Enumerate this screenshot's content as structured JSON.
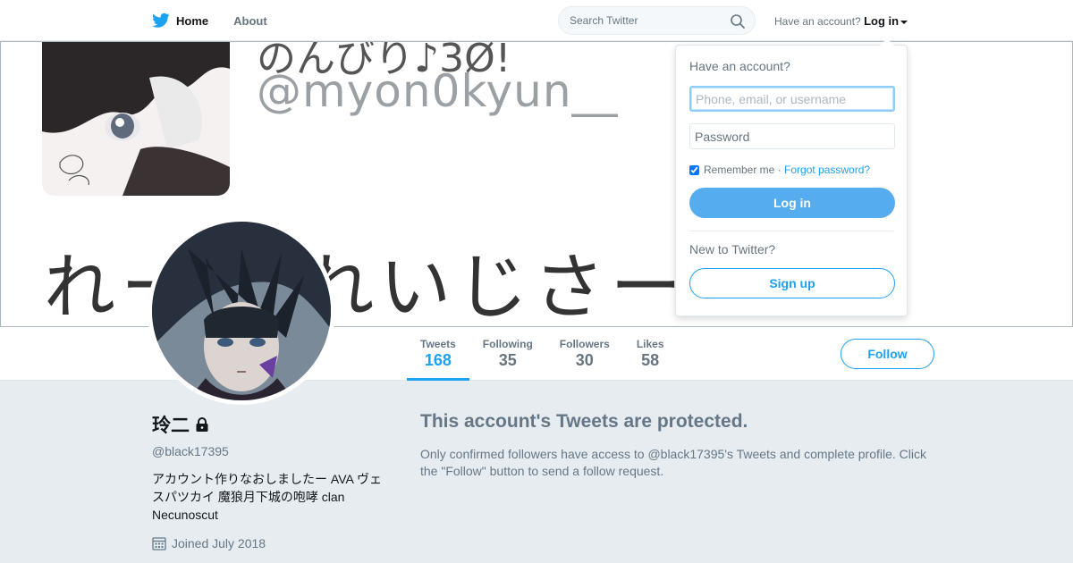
{
  "nav": {
    "home_label": "Home",
    "about_label": "About",
    "search_placeholder": "Search Twitter",
    "have_account_text": "Have an account?",
    "login_label": "Log in"
  },
  "banner": {
    "handle_text": "@myon0kyun__",
    "top_text": "のんびり♪3Ø!",
    "bottom_text": "れーじ れいじさー"
  },
  "profile_nav": {
    "stats": [
      {
        "label": "Tweets",
        "value": "168"
      },
      {
        "label": "Following",
        "value": "35"
      },
      {
        "label": "Followers",
        "value": "30"
      },
      {
        "label": "Likes",
        "value": "58"
      }
    ],
    "follow_label": "Follow"
  },
  "profile": {
    "name": "玲二",
    "handle": "@black17395",
    "bio": "アカウント作りなおしましたー AVA ヴェスパツカイ 魔狼月下城の咆哮 clan Necunoscut",
    "joined": "Joined July 2018"
  },
  "protected": {
    "title": "This account's Tweets are protected.",
    "message": "Only confirmed followers have access to @black17395's Tweets and complete profile. Click the \"Follow\" button to send a follow request."
  },
  "login_dropdown": {
    "title": "Have an account?",
    "username_placeholder": "Phone, email, or username",
    "password_placeholder": "Password",
    "remember_label": "Remember me",
    "separator": " · ",
    "forgot_label": "Forgot password?",
    "login_button": "Log in",
    "new_text": "New to Twitter?",
    "signup_button": "Sign up"
  },
  "colors": {
    "accent": "#1da1f2",
    "login_button_bg": "#55acee",
    "page_bg": "#e6ecf0",
    "muted_text": "#657786"
  },
  "icons": {
    "logo": "twitter-bird-icon",
    "search": "search-icon",
    "lock": "lock-icon",
    "calendar": "calendar-icon",
    "caret": "caret-down-icon"
  }
}
